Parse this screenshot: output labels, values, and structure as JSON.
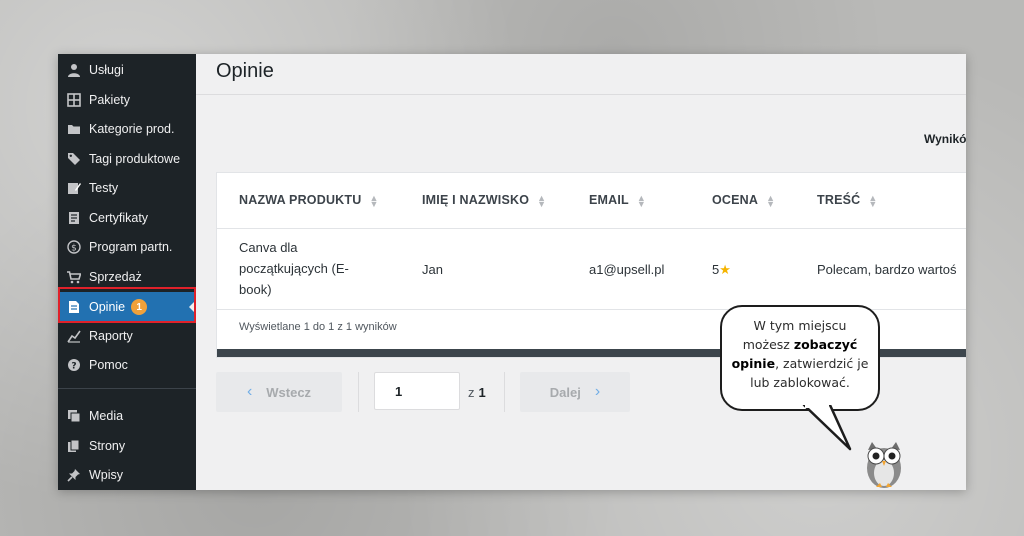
{
  "sidebar": {
    "items": [
      {
        "label": "Usługi",
        "icon": "users-icon"
      },
      {
        "label": "Pakiety",
        "icon": "grid-icon"
      },
      {
        "label": "Kategorie prod.",
        "icon": "folder-icon"
      },
      {
        "label": "Tagi produktowe",
        "icon": "tag-icon"
      },
      {
        "label": "Testy",
        "icon": "edit-icon"
      },
      {
        "label": "Certyfikaty",
        "icon": "certificate-icon"
      },
      {
        "label": "Program partn.",
        "icon": "dollar-icon"
      },
      {
        "label": "Sprzedaż",
        "icon": "cart-icon"
      },
      {
        "label": "Opinie",
        "icon": "document-icon",
        "badge": "1",
        "active": true
      },
      {
        "label": "Raporty",
        "icon": "chart-icon"
      },
      {
        "label": "Pomoc",
        "icon": "help-icon"
      },
      {
        "label": "Media",
        "icon": "media-icon"
      },
      {
        "label": "Strony",
        "icon": "pages-icon"
      },
      {
        "label": "Wpisy",
        "icon": "pin-icon"
      }
    ]
  },
  "page": {
    "title": "Opinie",
    "results_label": "Wynikó"
  },
  "table": {
    "columns": [
      "NAZWA PRODUKTU",
      "IMIĘ I NAZWISKO",
      "EMAIL",
      "OCENA",
      "TREŚĆ"
    ],
    "rows": [
      {
        "product_lines": [
          "Canva dla",
          "początkujących (E-",
          "book)"
        ],
        "name": "Jan",
        "email": "a1@upsell.pl",
        "rating": "5",
        "content": "Polecam, bardzo wartoś"
      }
    ],
    "footer": "Wyświetlane 1 do 1 z 1 wyników"
  },
  "pagination": {
    "prev_label": "Wstecz",
    "next_label": "Dalej",
    "current_page": "1",
    "of_label": "z",
    "total_pages": "1"
  },
  "callout": {
    "line1": "W tym miejscu",
    "line2_pre": "możesz ",
    "line2_bold": "zobaczyć",
    "line3_bold": "opinie",
    "line3_post": ", zatwierdzić je",
    "line4": "lub zablokować."
  },
  "colors": {
    "sidebar_bg": "#1d2327",
    "active_bg": "#2271b1",
    "highlight_border": "#e0212a",
    "badge": "#f0a13b"
  }
}
